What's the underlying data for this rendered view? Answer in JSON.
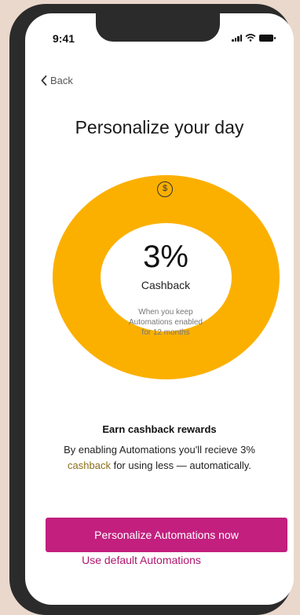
{
  "status_bar": {
    "time": "9:41"
  },
  "nav": {
    "back_label": "Back"
  },
  "page": {
    "title": "Personalize your day"
  },
  "reward": {
    "coin_symbol": "$",
    "percent": "3%",
    "label": "Cashback",
    "note": "When you keep Automations enabled for 12 months"
  },
  "info": {
    "title": "Earn cashback rewards",
    "desc_before": "By enabling Automations you'll recieve 3%",
    "desc_link": "cashback",
    "desc_after": "for using less — automatically."
  },
  "actions": {
    "primary_label": "Personalize Automations now",
    "secondary_label": "Use default Automations"
  },
  "colors": {
    "ring": "#fbb000",
    "primary_button": "#c21f7f",
    "link": "#b0166f",
    "background": "#ead8cd"
  }
}
